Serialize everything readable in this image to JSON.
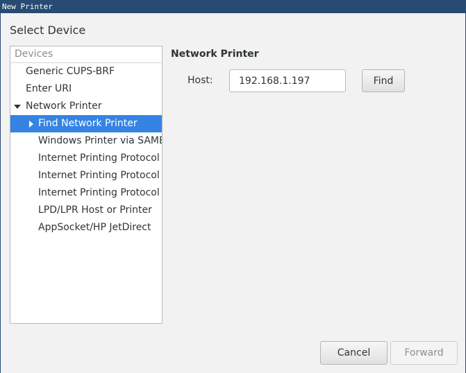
{
  "window": {
    "title": "New Printer"
  },
  "heading": "Select Device",
  "devices": {
    "header": "Devices",
    "items": [
      {
        "label": "Generic CUPS-BRF",
        "level": 0
      },
      {
        "label": "Enter URI",
        "level": 0
      },
      {
        "label": "Network Printer",
        "level": 0,
        "expanded": true
      },
      {
        "label": "Find Network Printer",
        "level": 1,
        "selected": true,
        "collapsed": true
      },
      {
        "label": "Windows Printer via SAMBA",
        "level": 1
      },
      {
        "label": "Internet Printing Protocol (ipp)",
        "level": 1
      },
      {
        "label": "Internet Printing Protocol (ipps)",
        "level": 1
      },
      {
        "label": "Internet Printing Protocol (https)",
        "level": 1
      },
      {
        "label": "LPD/LPR Host or Printer",
        "level": 1
      },
      {
        "label": "AppSocket/HP JetDirect",
        "level": 1
      }
    ]
  },
  "network_printer": {
    "title": "Network Printer",
    "host_label": "Host:",
    "host_value": "192.168.1.197",
    "find_label": "Find"
  },
  "footer": {
    "cancel_label": "Cancel",
    "forward_label": "Forward"
  },
  "colors": {
    "titlebar": "#274b72",
    "selection": "#3584e4",
    "background": "#f2f2f2"
  }
}
